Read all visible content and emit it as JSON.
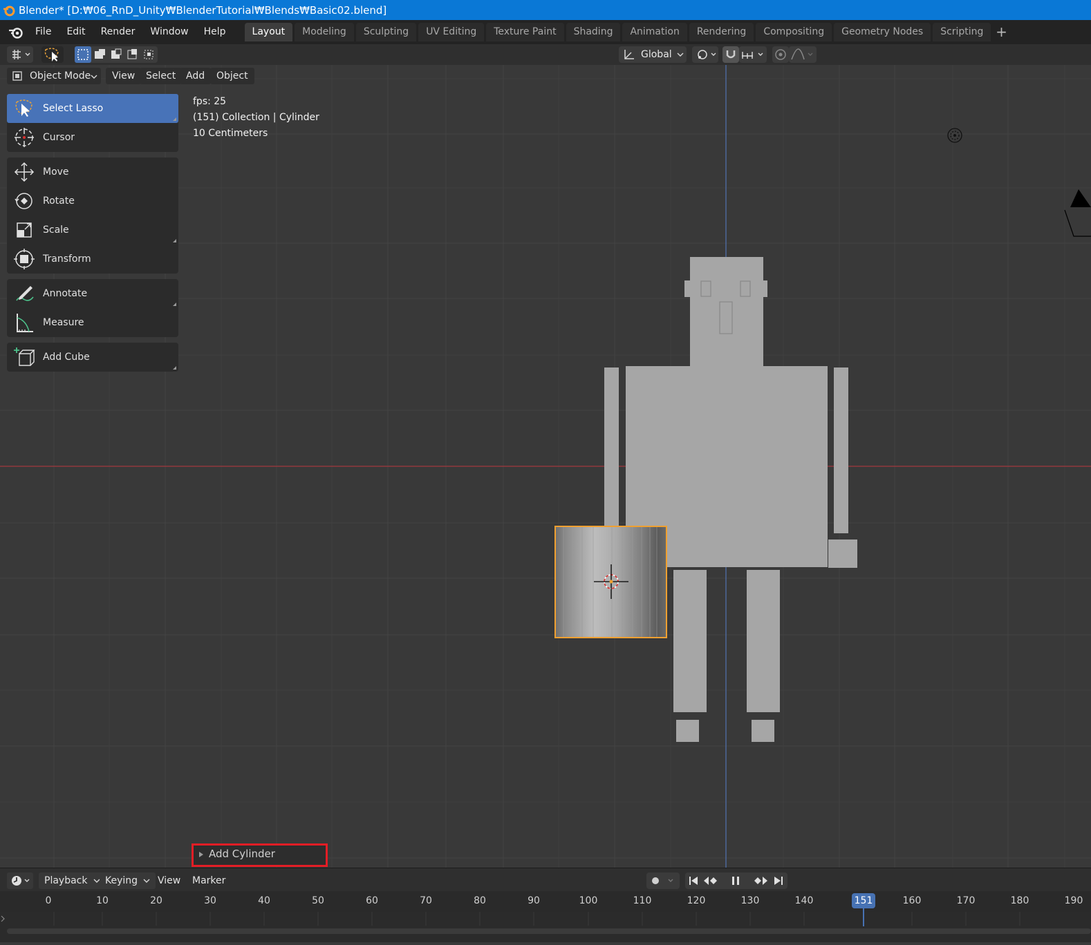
{
  "window": {
    "title": "Blender* [D:₩06_RnD_Unity₩BlenderTutorial₩Blends₩Basic02.blend]"
  },
  "menu": [
    "File",
    "Edit",
    "Render",
    "Window",
    "Help"
  ],
  "workspaces": [
    "Layout",
    "Modeling",
    "Sculpting",
    "UV Editing",
    "Texture Paint",
    "Shading",
    "Animation",
    "Rendering",
    "Compositing",
    "Geometry Nodes",
    "Scripting"
  ],
  "active_workspace": "Layout",
  "tool_header": {
    "transform_orientation": "Global"
  },
  "viewport_header": {
    "mode": "Object Mode",
    "menus": [
      "View",
      "Select",
      "Add",
      "Object"
    ]
  },
  "toolbar": {
    "items": [
      {
        "label": "Select Lasso",
        "icon": "select-lasso-icon",
        "active": true
      },
      {
        "label": "Cursor",
        "icon": "cursor-icon"
      },
      {
        "label": "Move",
        "icon": "move-icon"
      },
      {
        "label": "Rotate",
        "icon": "rotate-icon"
      },
      {
        "label": "Scale",
        "icon": "scale-icon"
      },
      {
        "label": "Transform",
        "icon": "transform-icon"
      },
      {
        "label": "Annotate",
        "icon": "annotate-icon"
      },
      {
        "label": "Measure",
        "icon": "measure-icon"
      },
      {
        "label": "Add Cube",
        "icon": "add-cube-icon"
      }
    ]
  },
  "overlay": {
    "fps": "fps: 25",
    "collection": "(151) Collection | Cylinder",
    "scale": "10 Centimeters"
  },
  "operator_panel": {
    "label": "Add Cylinder"
  },
  "timeline": {
    "menus": [
      "Playback",
      "Keying",
      "View",
      "Marker"
    ],
    "ruler_labels": [
      "0",
      "10",
      "20",
      "30",
      "40",
      "50",
      "60",
      "70",
      "80",
      "90",
      "100",
      "110",
      "120",
      "130",
      "140",
      "150",
      "160",
      "170",
      "180",
      "190"
    ],
    "current_frame": "151"
  },
  "colors": {
    "accent": "#4772b3",
    "selection": "#f0a030",
    "x_axis": "#a3383f",
    "y_axis": "#4f6ea8",
    "title_bar": "#0a78d6",
    "highlight_box": "#e31d25"
  }
}
